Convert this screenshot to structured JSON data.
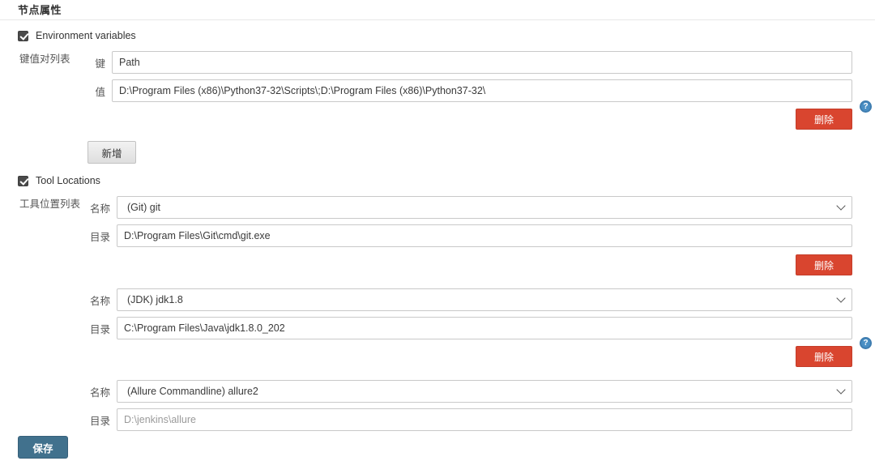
{
  "header": {
    "title": "节点属性"
  },
  "sections": {
    "env": {
      "checkbox_label": "Environment variables",
      "list_label": "键值对列表",
      "key_label": "键",
      "key_value": "Path",
      "value_label": "值",
      "value_value": "D:\\Program Files (x86)\\Python37-32\\Scripts\\;D:\\Program Files (x86)\\Python37-32\\",
      "delete_label": "删除",
      "add_label": "新增",
      "help_label": "?"
    },
    "tools": {
      "checkbox_label": "Tool Locations",
      "list_label": "工具位置列表",
      "name_label": "名称",
      "dir_label": "目录",
      "delete_label": "删除",
      "help_label": "?",
      "entries": [
        {
          "name": "(Git) git",
          "dir": "D:\\Program Files\\Git\\cmd\\git.exe"
        },
        {
          "name": "(JDK) jdk1.8",
          "dir": "C:\\Program Files\\Java\\jdk1.8.0_202"
        },
        {
          "name": "(Allure Commandline) allure2",
          "dir": "D:\\jenkins\\allure"
        }
      ]
    }
  },
  "footer": {
    "save_label": "保存"
  },
  "colors": {
    "delete_red": "#d9452f",
    "save_blue": "#41718d",
    "help_blue": "#4a8fc4"
  }
}
